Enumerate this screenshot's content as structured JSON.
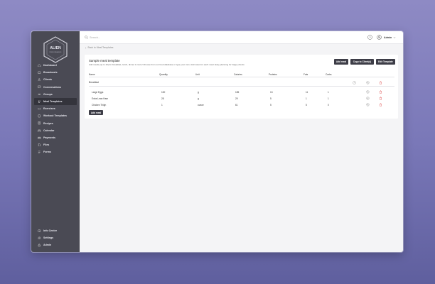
{
  "sidebar": {
    "logo_text": "ALIEN",
    "logo_sub": "PERFORMANCE",
    "items": [
      {
        "label": "Dashboard",
        "icon": "home-icon"
      },
      {
        "label": "Broadcasts",
        "icon": "broadcast-icon"
      },
      {
        "label": "Clients",
        "icon": "users-icon"
      },
      {
        "label": "Conversations",
        "icon": "chat-icon"
      },
      {
        "label": "Groups",
        "icon": "group-icon"
      },
      {
        "label": "Meal Templates",
        "icon": "meal-icon",
        "active": true
      },
      {
        "label": "Exercises",
        "icon": "dumbbell-icon"
      },
      {
        "label": "Workout Templates",
        "icon": "clipboard-icon"
      },
      {
        "label": "Recipes",
        "icon": "recipe-icon"
      },
      {
        "label": "Calendar",
        "icon": "calendar-icon"
      },
      {
        "label": "Payments",
        "icon": "card-icon"
      },
      {
        "label": "Files",
        "icon": "file-icon"
      },
      {
        "label": "Forms",
        "icon": "form-icon"
      }
    ],
    "bottom_items": [
      {
        "label": "Info Center",
        "icon": "info-icon"
      },
      {
        "label": "Settings",
        "icon": "gear-icon"
      },
      {
        "label": "Admin",
        "icon": "lock-icon"
      }
    ]
  },
  "topbar": {
    "search_placeholder": "Search...",
    "user_label": "Admin"
  },
  "back_link": "Back to Meal Templates",
  "template": {
    "title": "Sample meal template",
    "description": "Add meals (up to 10) for breakfast, lunch, dinner & more! Choose from our food database or type your own. Add notes for each meal. Easy planning for happy clients",
    "buttons": {
      "add_meal": "Add meal",
      "copy": "Copy to Client(s)",
      "edit": "Edit Template"
    },
    "columns": [
      "Name",
      "Quantity",
      "Unit",
      "Calories",
      "Proteins",
      "Fats",
      "Carbs"
    ],
    "meals": [
      {
        "name": "Breakfast",
        "foods": [
          {
            "name": "Large Eggs",
            "quantity": "100",
            "unit": "g",
            "calories": "155",
            "proteins": "13",
            "fats": "11",
            "carbs": "1"
          },
          {
            "name": "Extra Lean Ham",
            "quantity": "28",
            "unit": "g",
            "calories": "29",
            "proteins": "5",
            "fats": "1",
            "carbs": "1"
          },
          {
            "name": "Chicken Thigh",
            "quantity": "1",
            "unit": "ounce",
            "calories": "61",
            "proteins": "5",
            "fats": "5",
            "carbs": "0"
          }
        ]
      }
    ],
    "add_meal_bottom": "Add meal"
  },
  "colors": {
    "sidebar": "#4a4a54",
    "button": "#3d3d47",
    "delete": "#e05a5a"
  }
}
